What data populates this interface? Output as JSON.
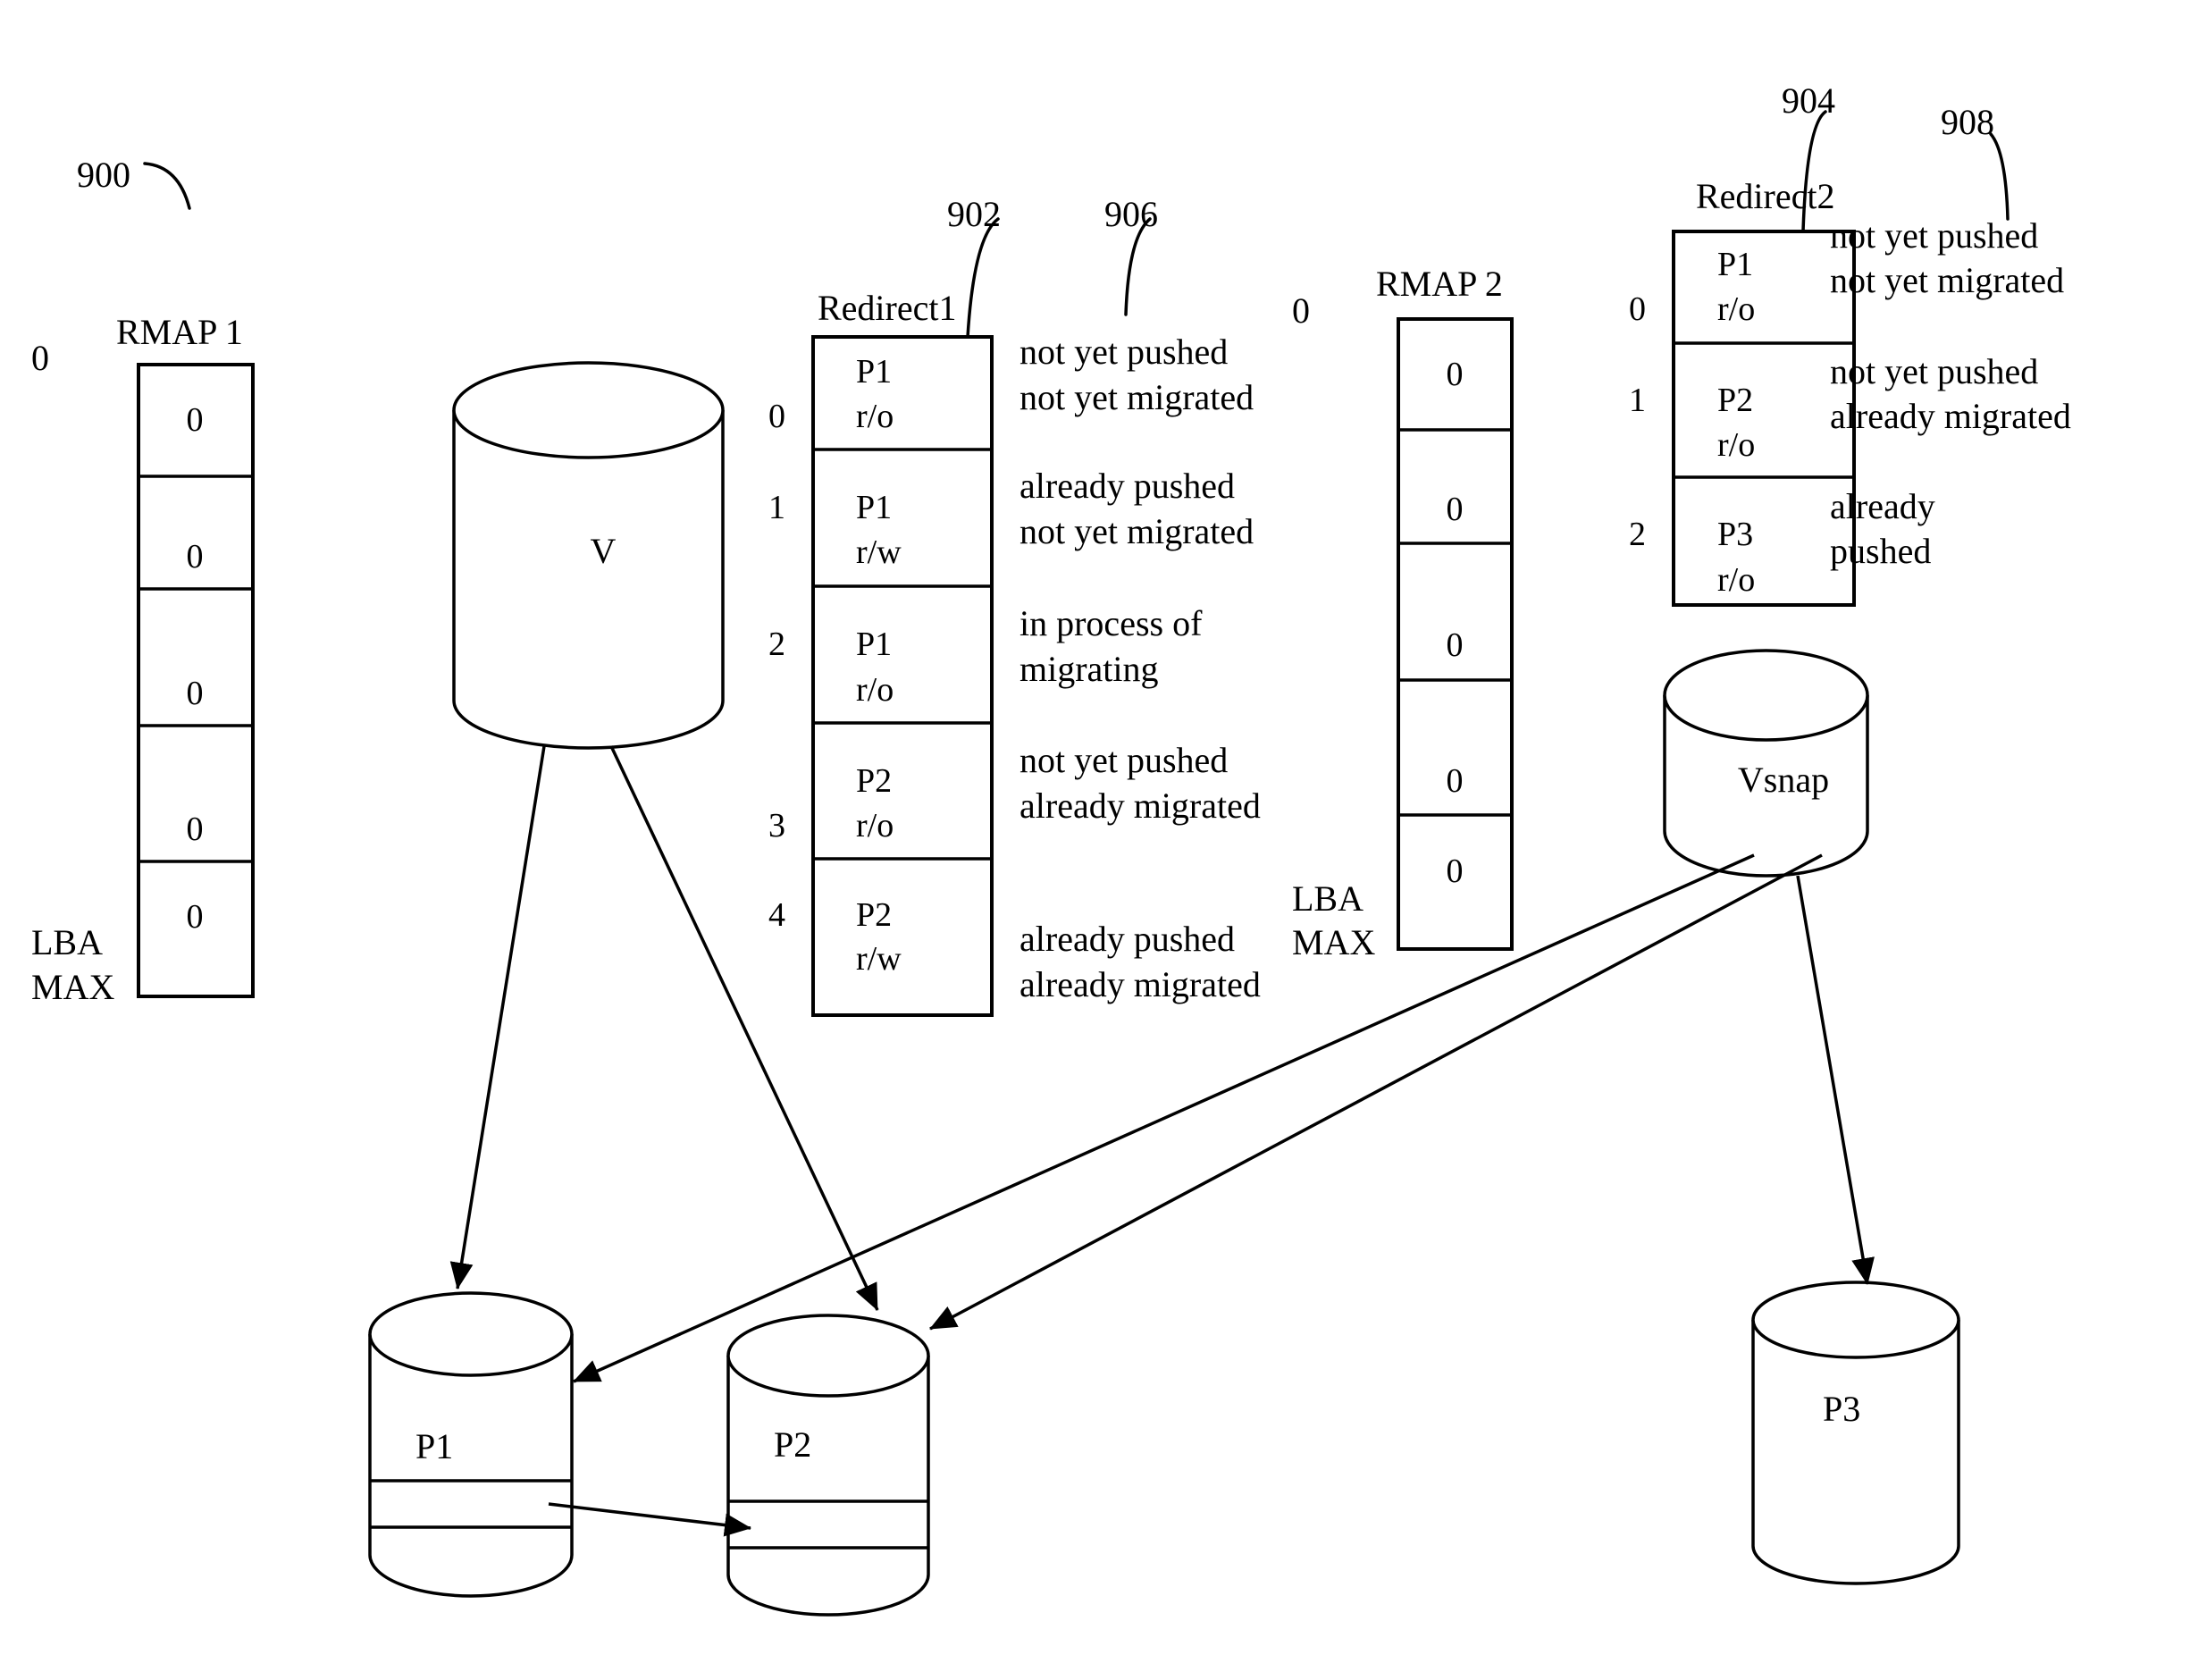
{
  "figure": {
    "ref_number": "900",
    "leader_refs": {
      "redirect1": "902",
      "redirect2": "904",
      "redirect1_states": "906",
      "redirect2_states": "908"
    }
  },
  "rmap1": {
    "title": "RMAP 1",
    "start_label": "0",
    "end_label_line1": "LBA",
    "end_label_line2": "MAX",
    "cells": [
      "0",
      "0",
      "0",
      "0",
      "0"
    ]
  },
  "rmap2": {
    "title": "RMAP 2",
    "start_label": "0",
    "end_label_line1": "LBA",
    "end_label_line2": "MAX",
    "cells": [
      "0",
      "0",
      "0",
      "0",
      "0"
    ]
  },
  "redirect1": {
    "title": "Redirect1",
    "rows": [
      {
        "index": "0",
        "volume": "P1",
        "mode": "r/o",
        "state_line1": "not yet pushed",
        "state_line2": "not yet migrated"
      },
      {
        "index": "1",
        "volume": "P1",
        "mode": "r/w",
        "state_line1": "already pushed",
        "state_line2": "not yet migrated"
      },
      {
        "index": "2",
        "volume": "P1",
        "mode": "r/o",
        "state_line1": "in process of",
        "state_line2": "migrating"
      },
      {
        "index": "3",
        "volume": "P2",
        "mode": "r/o",
        "state_line1": "not yet pushed",
        "state_line2": "already migrated"
      },
      {
        "index": "4",
        "volume": "P2",
        "mode": "r/w",
        "state_line1": "already pushed",
        "state_line2": "already migrated"
      }
    ]
  },
  "redirect2": {
    "title": "Redirect2",
    "rows": [
      {
        "index": "0",
        "volume": "P1",
        "mode": "r/o",
        "state_line1": "not yet pushed",
        "state_line2": "not yet migrated"
      },
      {
        "index": "1",
        "volume": "P2",
        "mode": "r/o",
        "state_line1": "not yet pushed",
        "state_line2": "already migrated"
      },
      {
        "index": "2",
        "volume": "P3",
        "mode": "r/o",
        "state_line1": "already",
        "state_line2": "pushed"
      }
    ]
  },
  "volumes": {
    "v": "V",
    "vsnap": "Vsnap",
    "p1": "P1",
    "p2": "P2",
    "p3": "P3"
  },
  "connections": [
    {
      "from": "V",
      "to": "P1"
    },
    {
      "from": "V",
      "to": "P2"
    },
    {
      "from": "Vsnap",
      "to": "P1"
    },
    {
      "from": "Vsnap",
      "to": "P2"
    },
    {
      "from": "Vsnap",
      "to": "P3"
    },
    {
      "from": "P1 band",
      "to": "P2 band"
    }
  ]
}
